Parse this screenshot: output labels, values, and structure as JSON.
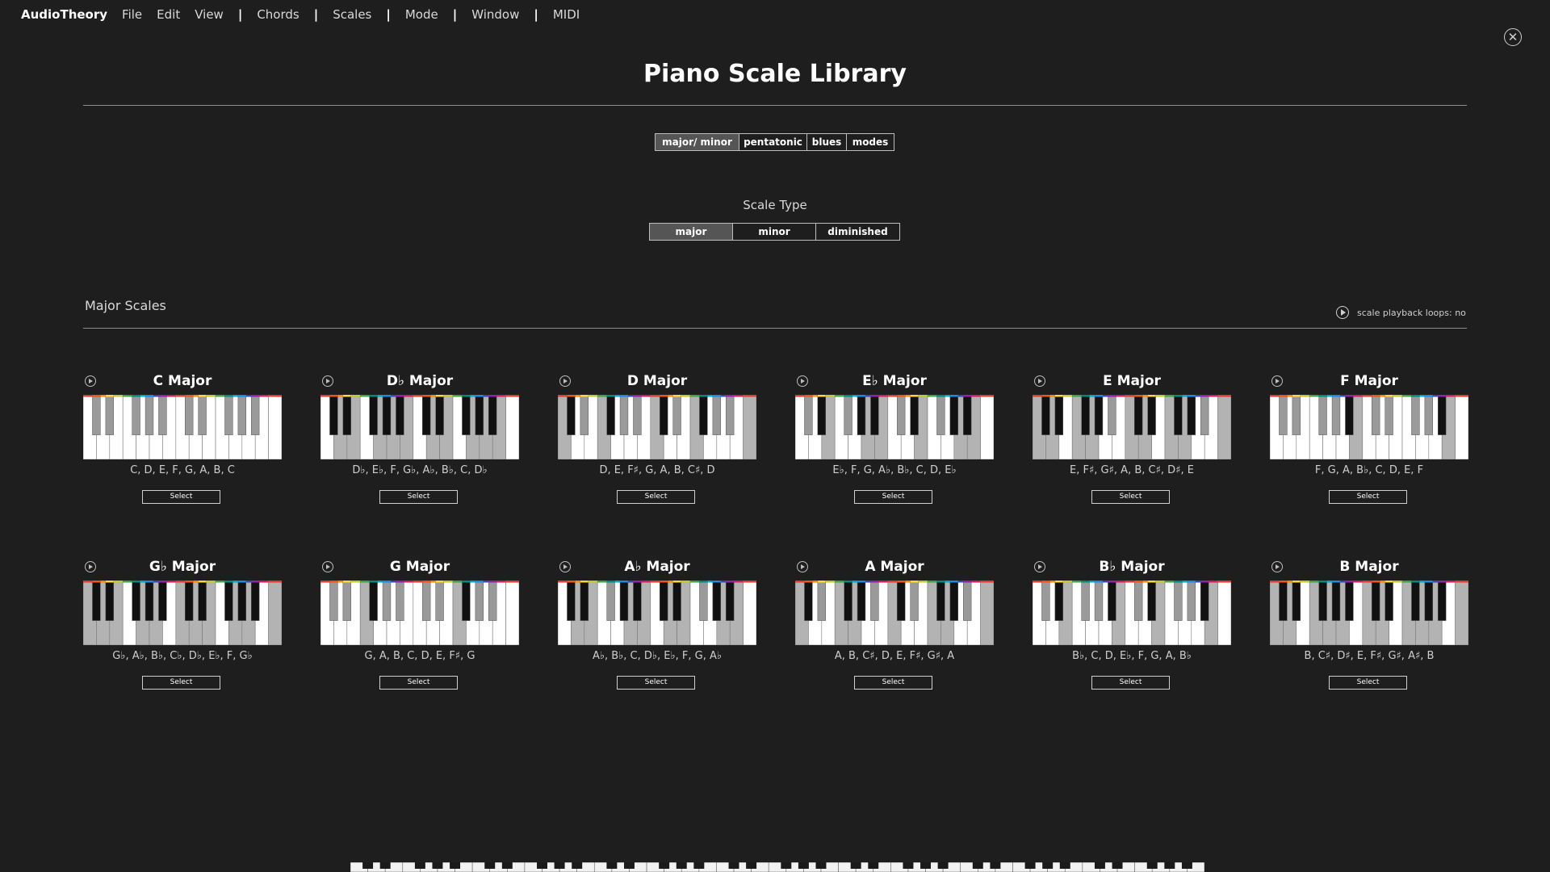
{
  "menubar": {
    "brand": "AudioTheory",
    "items": [
      "File",
      "Edit",
      "View"
    ],
    "items2": [
      "Chords"
    ],
    "items3": [
      "Scales"
    ],
    "items4": [
      "Mode"
    ],
    "items5": [
      "Window"
    ],
    "items6": [
      "MIDI"
    ],
    "separator": "|"
  },
  "close_icon": "close-icon",
  "page_title": "Piano Scale Library",
  "category_tabs": [
    {
      "label": "major/ minor",
      "active": true
    },
    {
      "label": "pentatonic",
      "active": false
    },
    {
      "label": "blues",
      "active": false
    },
    {
      "label": "modes",
      "active": false
    }
  ],
  "scale_type": {
    "label": "Scale Type",
    "options": [
      {
        "label": "major",
        "active": true
      },
      {
        "label": "minor",
        "active": false
      },
      {
        "label": "diminished",
        "active": false
      }
    ]
  },
  "section": {
    "title": "Major Scales",
    "loops_label": "scale playback loops: no",
    "loops_icon": "loop-icon"
  },
  "select_label": "Select",
  "play_icon": "play-icon",
  "scales": [
    {
      "name": "C Major",
      "notes": "C, D, E, F, G, A, B, C",
      "pcs": [
        0,
        2,
        4,
        5,
        7,
        9,
        11
      ]
    },
    {
      "name": "D♭ Major",
      "notes": "D♭, E♭, F, G♭, A♭, B♭, C, D♭",
      "pcs": [
        1,
        3,
        5,
        6,
        8,
        10,
        0
      ]
    },
    {
      "name": "D Major",
      "notes": "D, E, F♯, G, A, B, C♯, D",
      "pcs": [
        2,
        4,
        6,
        7,
        9,
        11,
        1
      ]
    },
    {
      "name": "E♭ Major",
      "notes": "E♭, F, G, A♭, B♭, C, D, E♭",
      "pcs": [
        3,
        5,
        7,
        8,
        10,
        0,
        2
      ]
    },
    {
      "name": "E Major",
      "notes": "E, F♯, G♯, A, B, C♯, D♯, E",
      "pcs": [
        4,
        6,
        8,
        9,
        11,
        1,
        3
      ]
    },
    {
      "name": "F Major",
      "notes": "F, G, A, B♭, C, D, E, F",
      "pcs": [
        5,
        7,
        9,
        10,
        0,
        2,
        4
      ]
    },
    {
      "name": "G♭ Major",
      "notes": "G♭, A♭, B♭, C♭, D♭, E♭, F, G♭",
      "pcs": [
        6,
        8,
        10,
        11,
        1,
        3,
        5
      ]
    },
    {
      "name": "G Major",
      "notes": "G, A, B, C, D, E, F♯, G",
      "pcs": [
        7,
        9,
        11,
        0,
        2,
        4,
        6
      ]
    },
    {
      "name": "A♭ Major",
      "notes": "A♭, B♭, C, D♭, E♭, F, G, A♭",
      "pcs": [
        8,
        10,
        0,
        1,
        3,
        5,
        7
      ]
    },
    {
      "name": "A Major",
      "notes": "A, B, C♯, D, E, F♯, G♯, A",
      "pcs": [
        9,
        11,
        1,
        2,
        4,
        6,
        8
      ]
    },
    {
      "name": "B♭ Major",
      "notes": "B♭, C, D, E♭, F, G, A, B♭",
      "pcs": [
        10,
        0,
        2,
        3,
        5,
        7,
        9
      ]
    },
    {
      "name": "B Major",
      "notes": "B, C♯, D♯, E, F♯, G♯, A♯, B",
      "pcs": [
        11,
        1,
        3,
        4,
        6,
        8,
        10
      ]
    }
  ],
  "colors": {
    "background": "#1e1e1e",
    "in_scale_white": "#ffffff",
    "out_scale_white": "#b3b3b3",
    "in_scale_black": "#111111",
    "out_scale_black": "#9a9a9a",
    "active_tab": "#555555",
    "note_colors": [
      "#e53935",
      "#f4511e",
      "#fb8c00",
      "#fdd835",
      "#c0ca33",
      "#43a047",
      "#00897b",
      "#00acc1",
      "#1e88e5",
      "#3949ab",
      "#8e24aa",
      "#d81b60"
    ]
  }
}
